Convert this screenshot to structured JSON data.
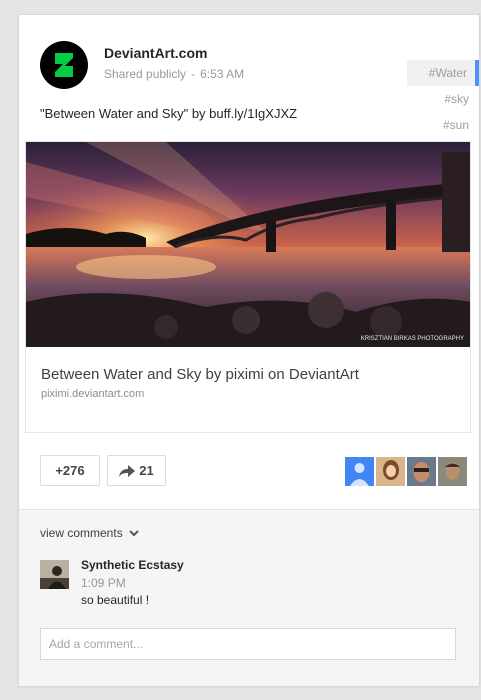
{
  "post": {
    "author": "DeviantArt.com",
    "visibility": "Shared publicly",
    "separator": "-",
    "time": "6:53 AM",
    "tags": [
      "#Water",
      "#sky",
      "#sun"
    ],
    "text": "\"Between Water and Sky\" by buff.ly/1IgXJXZ",
    "logo_icon": "deviantart-logo-icon",
    "colors": {
      "brand": "#05cc47",
      "tag_accent": "#4d90fe"
    }
  },
  "attachment": {
    "title": "Between Water and Sky by piximi on DeviantArt",
    "domain": "piximi.deviantart.com",
    "watermark": "KRISZTIAN BIRKAS PHOTOGRAPHY"
  },
  "actions": {
    "plus_count": "+276",
    "share_count": "21",
    "share_icon": "share-arrow-icon"
  },
  "comments": {
    "view_label": "view comments",
    "items": [
      {
        "author": "Synthetic Ecstasy",
        "time": "1:09 PM",
        "text": "so beautiful !"
      }
    ],
    "add_placeholder": "Add a comment..."
  }
}
